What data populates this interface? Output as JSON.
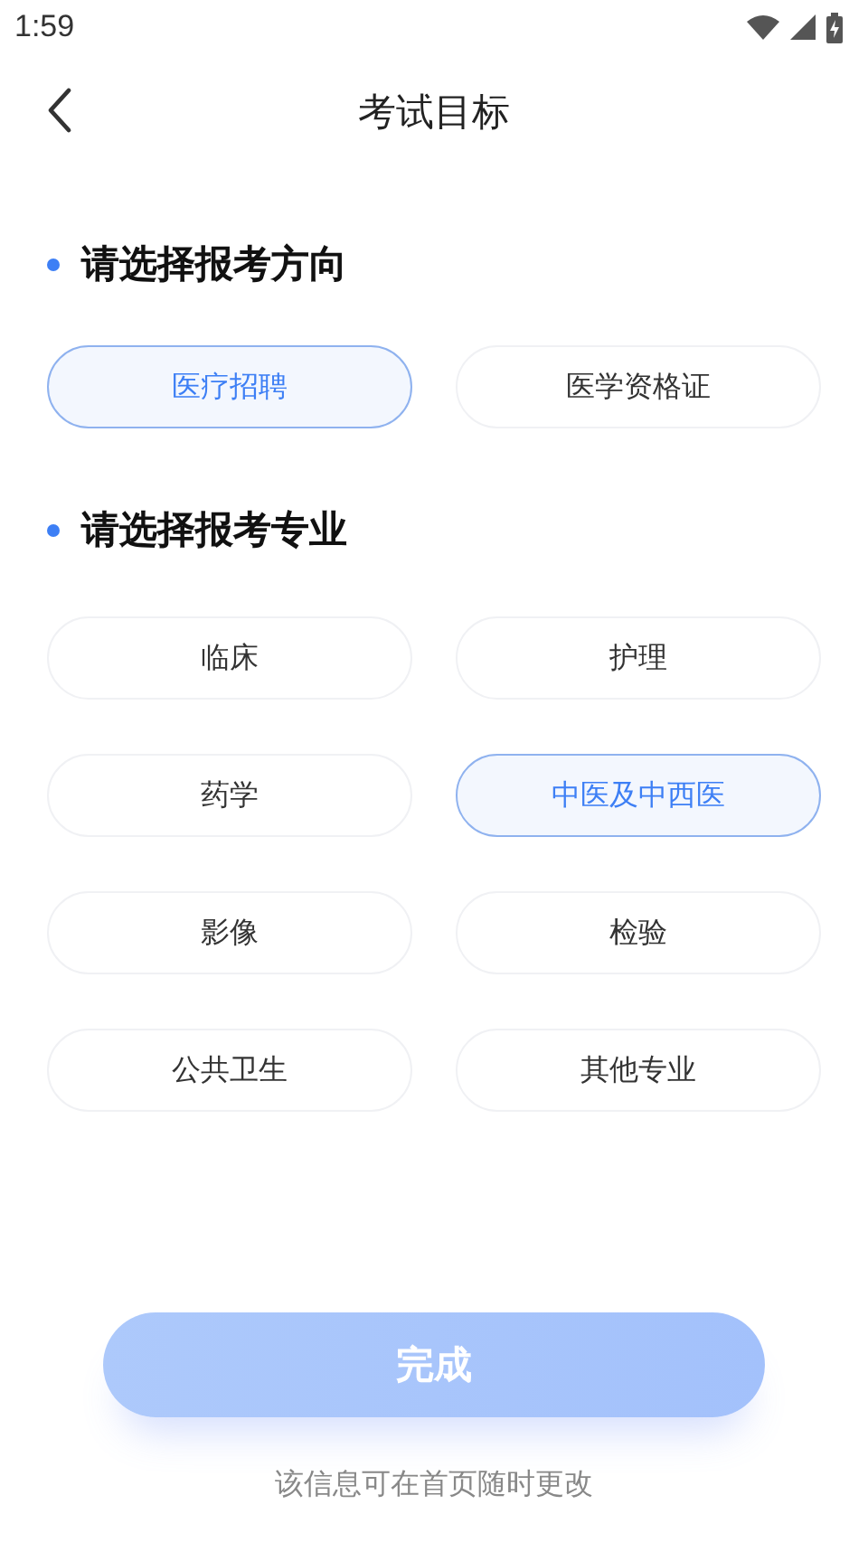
{
  "status_bar": {
    "time": "1:59"
  },
  "header": {
    "title": "考试目标"
  },
  "sections": [
    {
      "title": "请选择报考方向",
      "options": [
        {
          "label": "医疗招聘",
          "selected": true
        },
        {
          "label": "医学资格证",
          "selected": false
        }
      ]
    },
    {
      "title": "请选择报考专业",
      "options": [
        {
          "label": "临床",
          "selected": false
        },
        {
          "label": "护理",
          "selected": false
        },
        {
          "label": "药学",
          "selected": false
        },
        {
          "label": "中医及中西医",
          "selected": true
        },
        {
          "label": "影像",
          "selected": false
        },
        {
          "label": "检验",
          "selected": false
        },
        {
          "label": "公共卫生",
          "selected": false
        },
        {
          "label": "其他专业",
          "selected": false
        }
      ]
    }
  ],
  "done_button": {
    "label": "完成",
    "disabled": true
  },
  "footer_note": "该信息可在首页随时更改"
}
